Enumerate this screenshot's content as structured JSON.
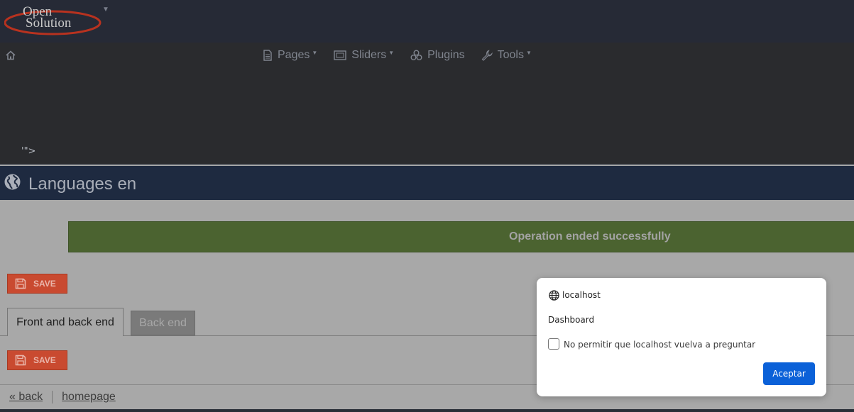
{
  "header": {
    "logo_line1": "Open",
    "logo_line2": "Solution"
  },
  "nav": {
    "items": [
      {
        "label": "Pages",
        "icon": "page-icon",
        "has_dropdown": true
      },
      {
        "label": "Sliders",
        "icon": "image-icon",
        "has_dropdown": true
      },
      {
        "label": "Plugins",
        "icon": "plugins-icon",
        "has_dropdown": false
      },
      {
        "label": "Tools",
        "icon": "wrench-icon",
        "has_dropdown": true
      }
    ],
    "stray_text": "'\">"
  },
  "page": {
    "title": "Languages en",
    "success_message": "Operation ended successfully",
    "save_label": "SAVE",
    "tabs": [
      {
        "label": "Front and back end",
        "active": true
      },
      {
        "label": "Back end",
        "active": false
      }
    ],
    "footer": {
      "back": "« back",
      "homepage": "homepage"
    }
  },
  "dialog": {
    "host": "localhost",
    "message": "Dashboard",
    "checkbox_label": "No permitir que localhost vuelva a preguntar",
    "checkbox_checked": false,
    "accept_label": "Aceptar"
  },
  "colors": {
    "header_bg": "#262a36",
    "nav_bg": "#2a2b2e",
    "title_bg": "#1e2a40",
    "success_bg": "#4b6330",
    "save_bg": "#c94a30",
    "accept_bg": "#0b61d8"
  }
}
